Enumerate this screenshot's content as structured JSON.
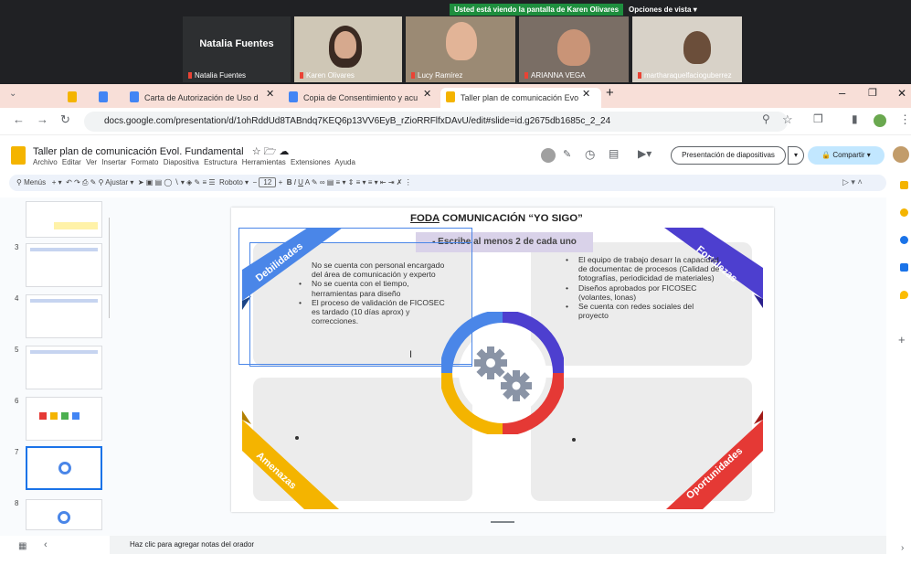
{
  "meeting": {
    "banner": "Usted está viendo la pantalla de Karen Olivares",
    "view_options": "Opciones de vista",
    "presenter_name": "Natalia Fuentes",
    "participants": [
      "Natalia Fuentes",
      "Karen Olivares",
      "Lucy Ramírez",
      "ARIANNA VEGA",
      "martharaquelfacioguberrez"
    ]
  },
  "browser": {
    "tabs": [
      "Carta de Autorización de Uso d",
      "Copia de Consentimiento y acu",
      "Taller plan de comunicación Evo"
    ],
    "url": "docs.google.com/presentation/d/1ohRddUd8TABndq7KEQ6p13VV6EyB_rZioRRFlfxDAvU/edit#slide=id.g2675db1685c_2_24"
  },
  "doc": {
    "title": "Taller plan de comunicación Evol. Fundamental",
    "menus": [
      "Archivo",
      "Editar",
      "Ver",
      "Insertar",
      "Formato",
      "Diapositiva",
      "Estructura",
      "Herramientas",
      "Extensiones",
      "Ayuda"
    ],
    "present_label": "Presentación de diapositivas",
    "share_label": "Compartir",
    "toolbar": {
      "menus": "Menús",
      "fit": "Ajustar",
      "font": "Roboto",
      "size": "12"
    }
  },
  "filmstrip": {
    "numbers": [
      "3",
      "4",
      "5",
      "6",
      "7",
      "8"
    ]
  },
  "slide": {
    "title_underlined": "FODA",
    "title_rest": " COMUNICACIÓN “YO SIGO”",
    "subtitle": "- Escribe al menos 2 de cada uno",
    "ribbons": {
      "weak": "Debilidades",
      "strong": "Fortalezas",
      "threats": "Amenazas",
      "opps": "Oportunidades"
    },
    "weak_intro": "No se cuenta con personal encargado del área de comunicación y experto",
    "weak_items": [
      "No se cuenta con el tiempo, herramientas para diseño",
      "El proceso de validación de FICOSEC es tardado (10 días aprox) y correcciones."
    ],
    "strong_items": [
      "El equipo de trabajo desarr la capacidad de documentac de procesos (Calidad de fotografías, periodicidad de materiales)",
      "Diseños aprobados por FICOSEC (volantes, lonas)",
      "Se cuenta con redes sociales del proyecto"
    ]
  },
  "notes": "Haz clic para agregar notas del orador",
  "colors": {
    "blue": "#4a86e8",
    "purple": "#4d3fcf",
    "yellow": "#f4b400",
    "red": "#e53935",
    "gear": "#8a94a6"
  }
}
